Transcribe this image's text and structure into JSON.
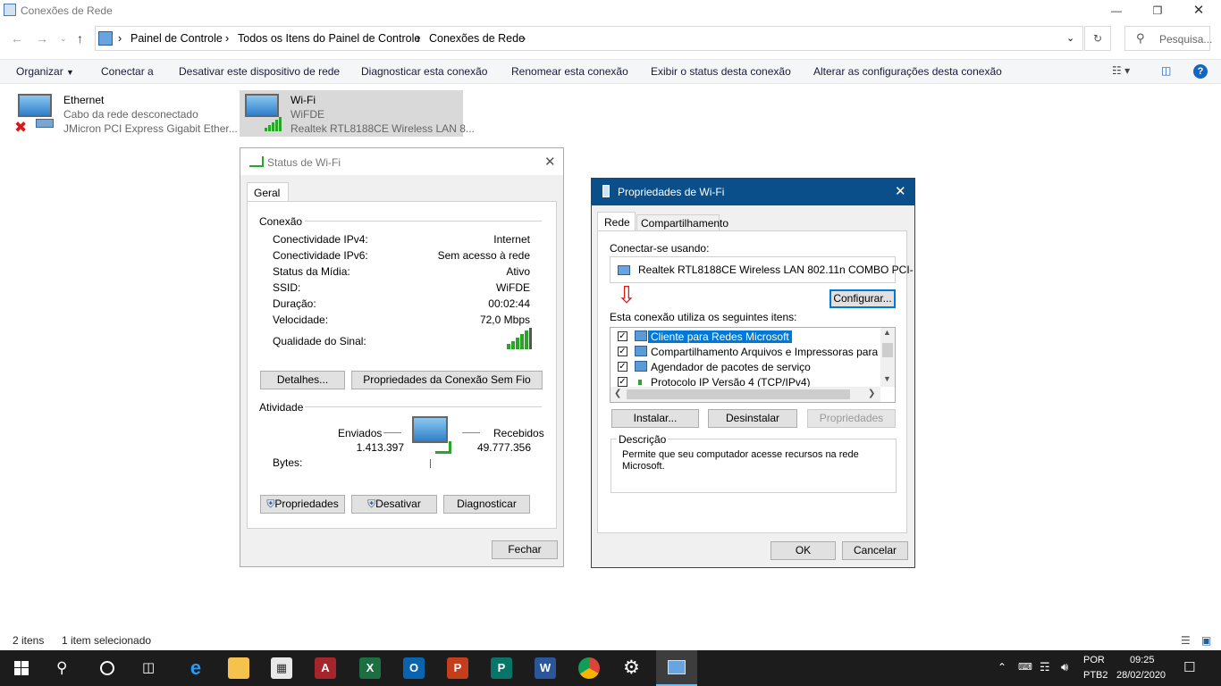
{
  "window": {
    "title": "Conexões de Rede"
  },
  "address": {
    "breadcrumbs": [
      "Painel de Controle",
      "Todos os Itens do Painel de Controle",
      "Conexões de Rede"
    ],
    "search_placeholder": "Pesquisa..."
  },
  "toolbar": {
    "organize": "Organizar",
    "connect": "Conectar a",
    "disable": "Desativar este dispositivo de rede",
    "diagnose": "Diagnosticar esta conexão",
    "rename": "Renomear esta conexão",
    "status": "Exibir o status desta conexão",
    "change": "Alterar as configurações desta conexão"
  },
  "connections": [
    {
      "name": "Ethernet",
      "status": "Cabo da rede desconectado",
      "adapter": "JMicron PCI Express Gigabit Ether..."
    },
    {
      "name": "Wi-Fi",
      "status": "WiFDE",
      "adapter": "Realtek RTL8188CE Wireless LAN 8..."
    }
  ],
  "status_dialog": {
    "title": "Status de Wi-Fi",
    "tab": "Geral",
    "connection_header": "Conexão",
    "rows": [
      {
        "label": "Conectividade IPv4:",
        "value": "Internet"
      },
      {
        "label": "Conectividade IPv6:",
        "value": "Sem acesso à rede"
      },
      {
        "label": "Status da Mídia:",
        "value": "Ativo"
      },
      {
        "label": "SSID:",
        "value": "WiFDE"
      },
      {
        "label": "Duração:",
        "value": "00:02:44"
      },
      {
        "label": "Velocidade:",
        "value": "72,0 Mbps"
      }
    ],
    "signal_label": "Qualidade do Sinal:",
    "details_btn": "Detalhes...",
    "wireless_props_btn": "Propriedades da Conexão Sem Fio",
    "activity_header": "Atividade",
    "sent_label": "Enviados",
    "received_label": "Recebidos",
    "bytes_label": "Bytes:",
    "sent_value": "1.413.397",
    "received_value": "49.777.356",
    "properties_btn": "Propriedades",
    "disable_btn": "Desativar",
    "diagnose_btn": "Diagnosticar",
    "close_btn": "Fechar"
  },
  "props_dialog": {
    "title": "Propriedades de Wi-Fi",
    "tabs": [
      "Rede",
      "Compartilhamento"
    ],
    "connect_using": "Conectar-se usando:",
    "adapter": "Realtek RTL8188CE Wireless LAN 802.11n COMBO PCI-",
    "configure_btn": "Configurar...",
    "items_label": "Esta conexão utiliza os seguintes itens:",
    "items": [
      "Cliente para Redes Microsoft",
      "Compartilhamento Arquivos e Impressoras para Redes",
      "Agendador de pacotes de serviço",
      "Protocolo IP Versão 4 (TCP/IPv4)"
    ],
    "install_btn": "Instalar...",
    "uninstall_btn": "Desinstalar",
    "properties_btn": "Propriedades",
    "description_header": "Descrição",
    "description": "Permite que seu computador acesse recursos na rede Microsoft.",
    "ok_btn": "OK",
    "cancel_btn": "Cancelar"
  },
  "statusbar": {
    "count": "2 itens",
    "selected": "1 item selecionado"
  },
  "taskbar": {
    "language": "POR",
    "keyboard": "PTB2",
    "time": "09:25",
    "date": "28/02/2020"
  },
  "colors": {
    "accent": "#0078d7",
    "dialog_title": "#0b4f8a",
    "taskbar": "#1c1c1c"
  }
}
